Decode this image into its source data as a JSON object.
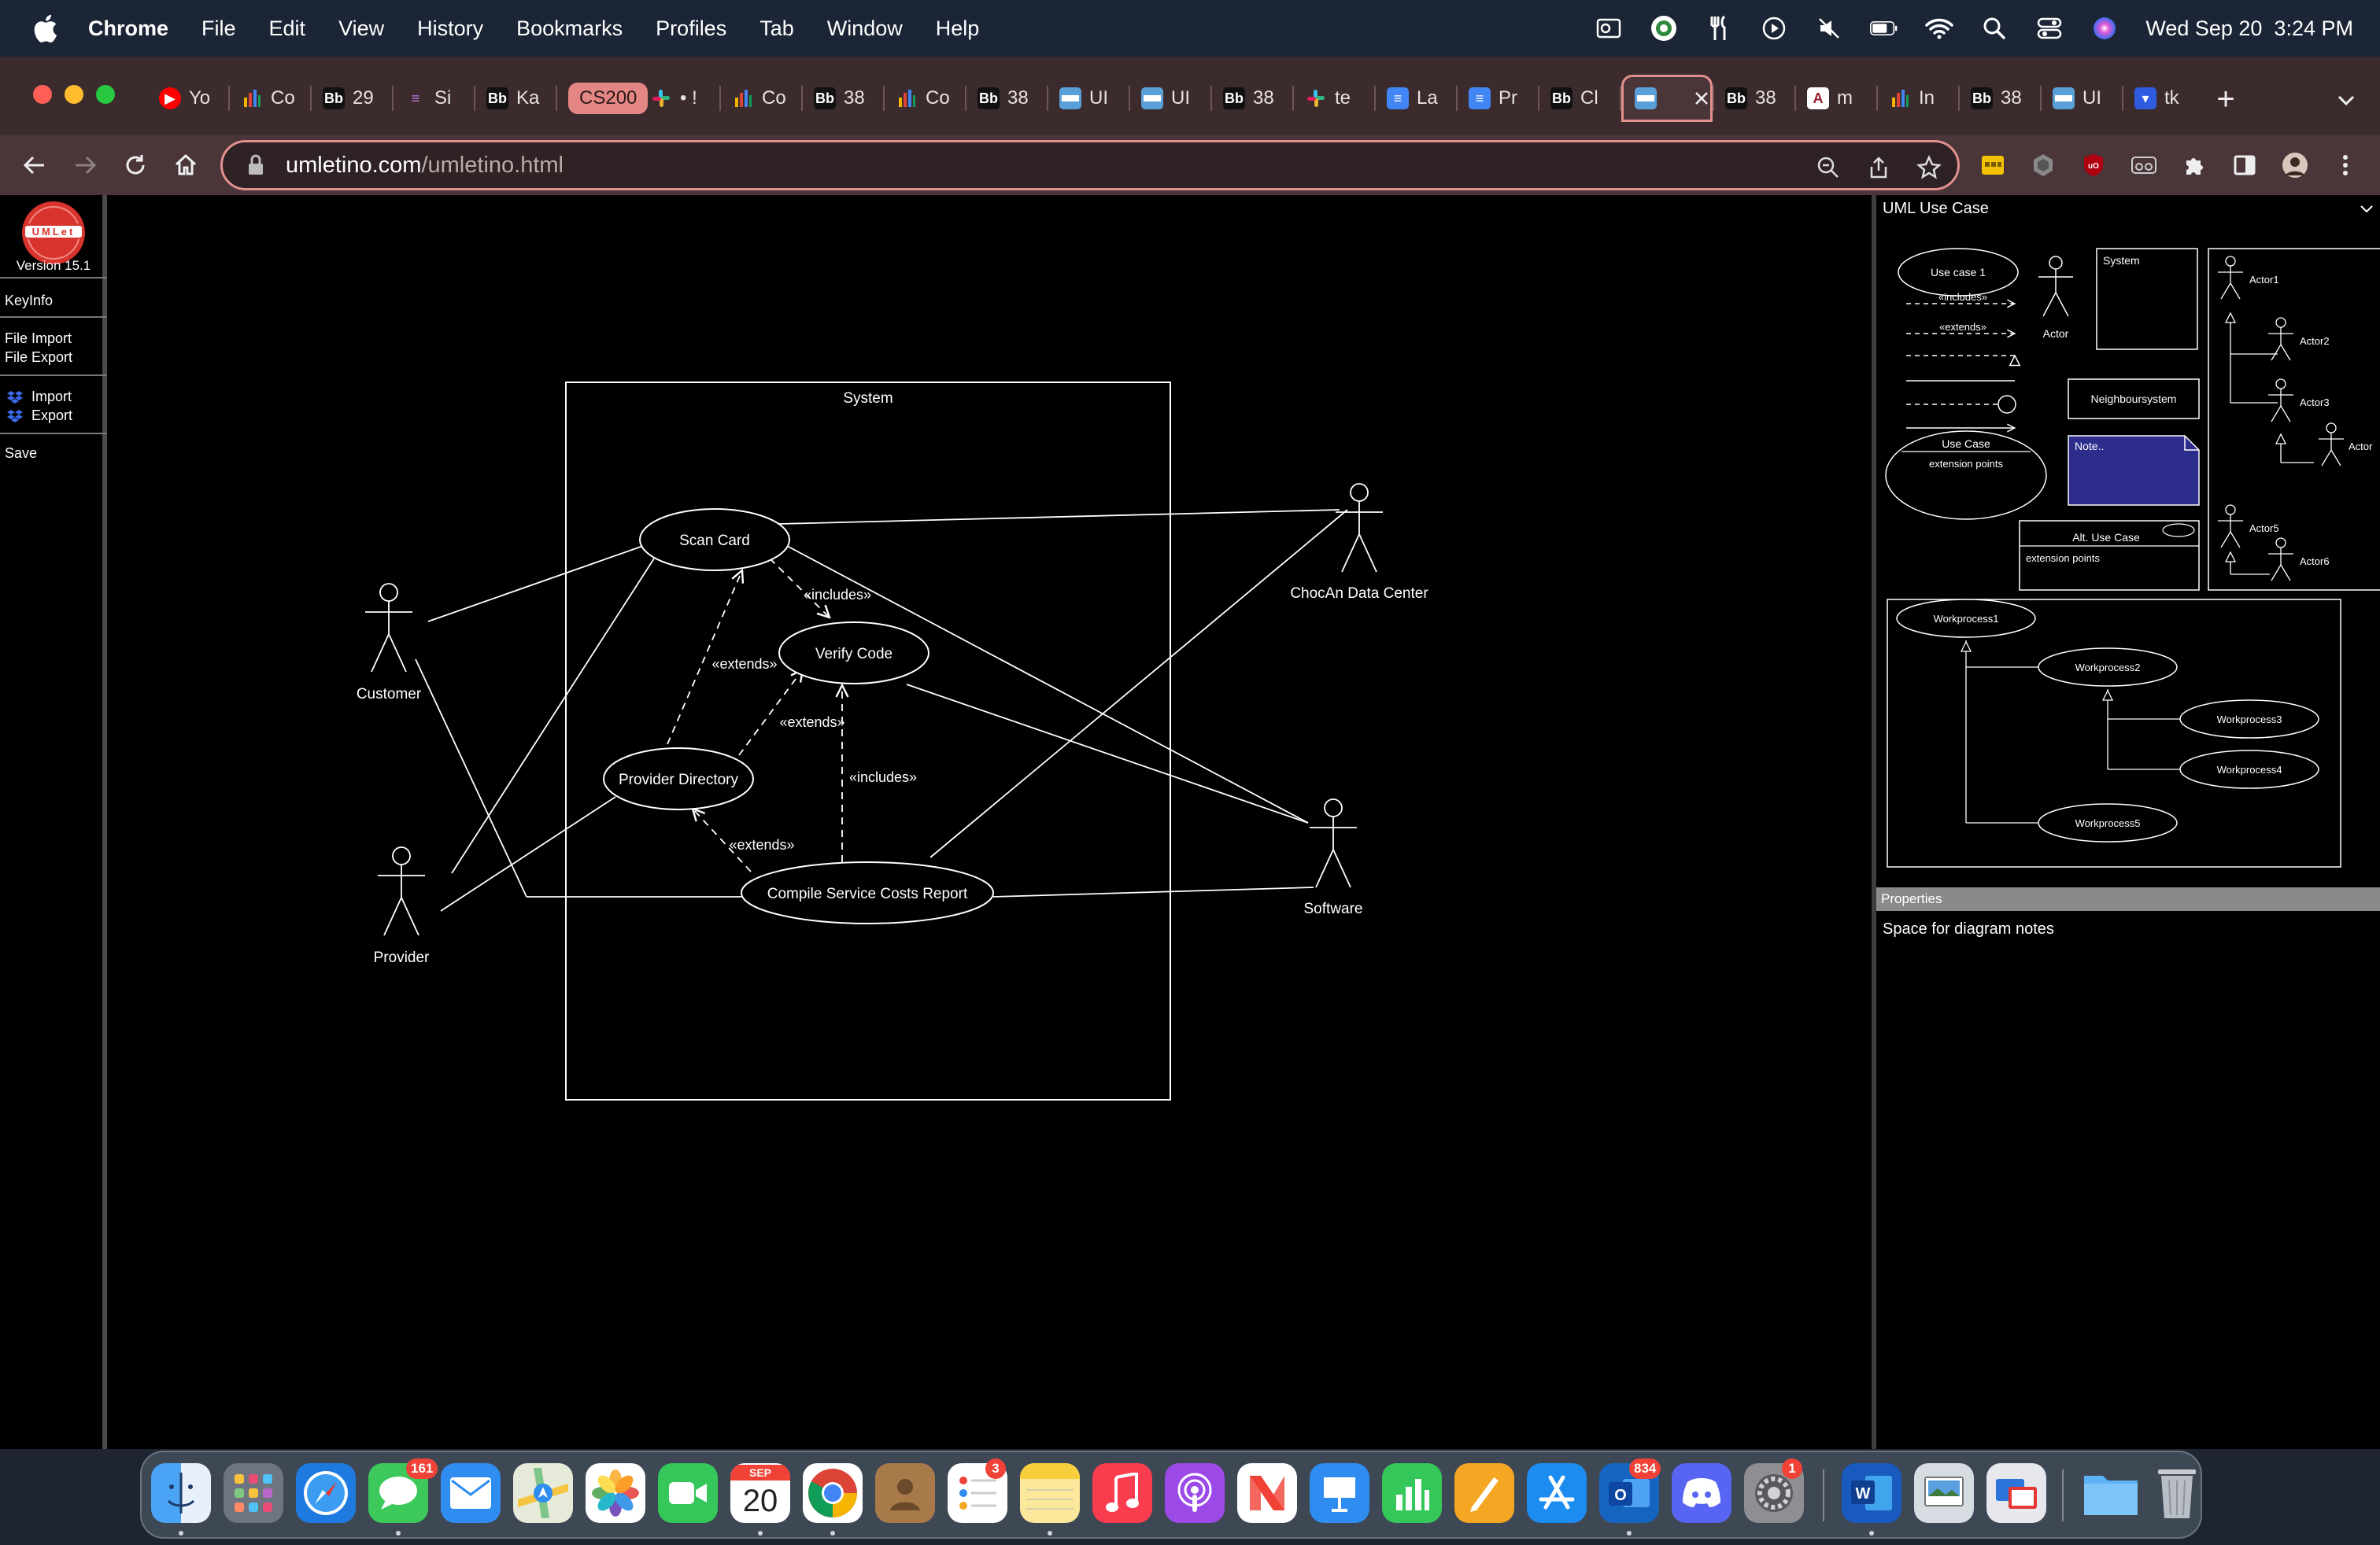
{
  "menubar": {
    "app_name": "Chrome",
    "items": [
      "File",
      "Edit",
      "View",
      "History",
      "Bookmarks",
      "Profiles",
      "Tab",
      "Window",
      "Help"
    ],
    "datetime": "Wed Sep 20  3:24 PM"
  },
  "tabs": [
    {
      "label": "Yo",
      "icon": "youtube-icon"
    },
    {
      "label": "Co",
      "icon": "chart-icon"
    },
    {
      "label": "29",
      "icon": "blackboard-icon"
    },
    {
      "label": "Si",
      "icon": "siri-icon"
    },
    {
      "label": "Ka",
      "icon": "blackboard-icon"
    },
    {
      "label": "CS200",
      "icon": "none"
    },
    {
      "label": "• !",
      "icon": "slack-icon"
    },
    {
      "label": "Co",
      "icon": "chart-icon"
    },
    {
      "label": "38",
      "icon": "blackboard-icon"
    },
    {
      "label": "Co",
      "icon": "chart-icon"
    },
    {
      "label": "38",
      "icon": "blackboard-icon"
    },
    {
      "label": "UI",
      "icon": "umlet-icon"
    },
    {
      "label": "UI",
      "icon": "umlet-icon"
    },
    {
      "label": "38",
      "icon": "blackboard-icon"
    },
    {
      "label": "te",
      "icon": "slack-icon"
    },
    {
      "label": "La",
      "icon": "docs-icon"
    },
    {
      "label": "Pr",
      "icon": "docs-icon"
    },
    {
      "label": "Cl",
      "icon": "blackboard-icon"
    },
    {
      "label": "",
      "icon": "umlet-icon"
    },
    {
      "label": "38",
      "icon": "blackboard-icon"
    },
    {
      "label": "m",
      "icon": "alabama-icon"
    },
    {
      "label": "In",
      "icon": "chart-icon"
    },
    {
      "label": "38",
      "icon": "blackboard-icon"
    },
    {
      "label": "UI",
      "icon": "umlet-icon"
    },
    {
      "label": "tk",
      "icon": "shield-icon"
    }
  ],
  "favicon_text": {
    "blackboard": "Bb"
  },
  "omnibox": {
    "domain": "umletino.com",
    "path": "/umletino.html"
  },
  "leftpanel": {
    "logo_text": "UMLet",
    "version": "Version 15.1",
    "keyinfo": "KeyInfo",
    "file_import": "File Import",
    "file_export": "File Export",
    "import": "Import",
    "export": "Export",
    "save": "Save"
  },
  "diagram": {
    "system_title": "System",
    "use_cases": {
      "scan_card": "Scan Card",
      "verify_code": "Verify Code",
      "provider_directory": "Provider Directory",
      "compile_report": "Compile Service Costs Report"
    },
    "actors": {
      "customer": "Customer",
      "provider": "Provider",
      "chocan": "ChocAn Data Center",
      "software": "Software"
    },
    "relations": {
      "includes_1": "«includes»",
      "extends_1": "«extends»",
      "extends_2": "«extends»",
      "includes_2": "«includes»",
      "extends_3": "«extends»"
    }
  },
  "palette": {
    "title": "UML Use Case",
    "use_case_1": "Use case 1",
    "includes": "«includes»",
    "extends": "«extends»",
    "actor": "Actor",
    "system": "System",
    "neighbour": "Neighboursystem",
    "use_case_ext": "Use Case",
    "extension_points": "extension points",
    "note": "Note..",
    "alt_use_case": "Alt. Use Case",
    "alt_extension_points": "extension points",
    "actors": [
      "Actor1",
      "Actor2",
      "Actor3",
      "Actor",
      "Actor5",
      "Actor6"
    ],
    "workprocesses": [
      "Workprocess1",
      "Workprocess2",
      "Workprocess3",
      "Workprocess4",
      "Workprocess5"
    ]
  },
  "properties": {
    "title": "Properties",
    "notes": "Space for diagram notes"
  },
  "dock": {
    "badges": {
      "messages": "161",
      "reminders": "3",
      "outlook": "834",
      "settings": "1"
    },
    "calendar_month": "SEP",
    "calendar_day": "20"
  },
  "colors": {
    "accent_tab": "#e48684",
    "canvas_bg": "#000000",
    "note_fill": "#2d2d8c"
  }
}
